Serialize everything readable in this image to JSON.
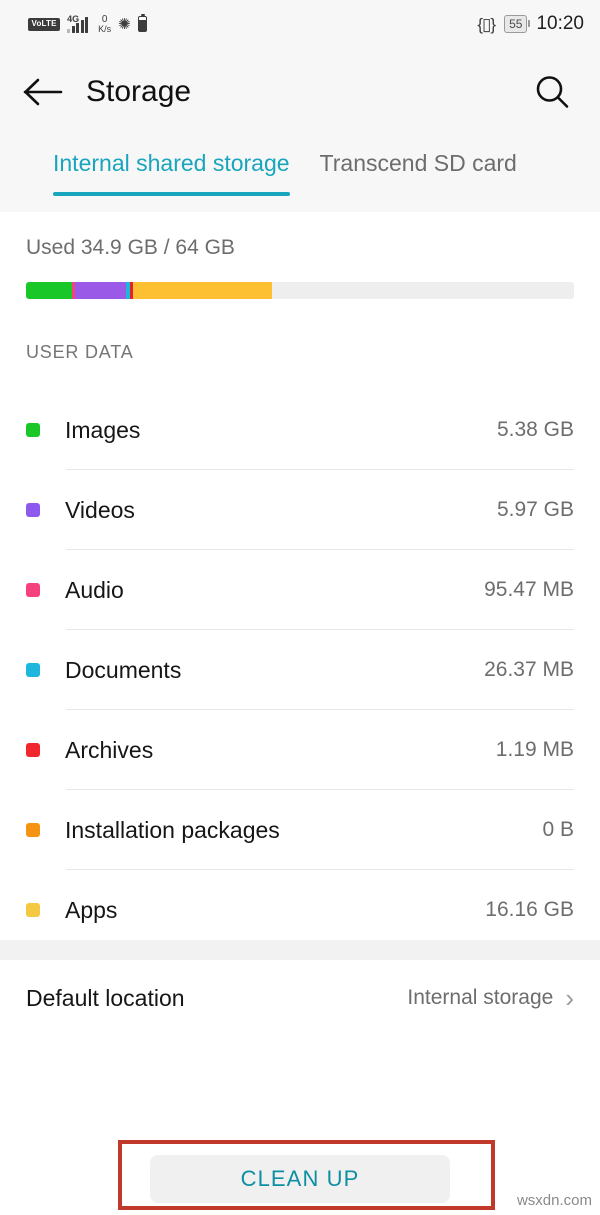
{
  "status_bar": {
    "volte_label": "VoLTE",
    "network_gen": "4G",
    "net_speed_value": "0",
    "net_speed_unit": "K/s",
    "bluetooth_icon": "bluetooth-icon",
    "battery_percent": "55",
    "time": "10:20"
  },
  "app_bar": {
    "back_icon": "back-arrow-icon",
    "title": "Storage",
    "search_icon": "search-icon"
  },
  "tabs": [
    {
      "label": "Internal shared storage",
      "active": true
    },
    {
      "label": "Transcend SD card",
      "active": false
    }
  ],
  "usage": {
    "used_text": "Used 34.9 GB / 64 GB",
    "used_gb": 34.9,
    "total_gb": 64,
    "segments": [
      {
        "name": "Images",
        "color": "#19c728",
        "percent": 8.4
      },
      {
        "name": "Audio",
        "color": "#f5427e",
        "percent": 0.6
      },
      {
        "name": "Videos",
        "color": "#9b59e8",
        "percent": 9.3
      },
      {
        "name": "Documents",
        "color": "#1fb6dd",
        "percent": 0.7
      },
      {
        "name": "Archives",
        "color": "#e8202a",
        "percent": 0.6
      },
      {
        "name": "Apps",
        "color": "#fcc032",
        "percent": 25.3
      }
    ],
    "track_color": "#eeeeee"
  },
  "section": {
    "user_data_heading": "USER DATA"
  },
  "categories": [
    {
      "label": "Images",
      "value": "5.38 GB",
      "color": "#19c728"
    },
    {
      "label": "Videos",
      "value": "5.97 GB",
      "color": "#8e59ef"
    },
    {
      "label": "Audio",
      "value": "95.47 MB",
      "color": "#f5427e"
    },
    {
      "label": "Documents",
      "value": "26.37 MB",
      "color": "#1fb6dd"
    },
    {
      "label": "Archives",
      "value": "1.19 MB",
      "color": "#f0272d"
    },
    {
      "label": "Installation packages",
      "value": "0 B",
      "color": "#f59412"
    },
    {
      "label": "Apps",
      "value": "16.16 GB",
      "color": "#f5c842"
    }
  ],
  "default_location": {
    "label": "Default location",
    "value": "Internal storage",
    "chevron_icon": "chevron-right-icon"
  },
  "cleanup": {
    "label": "CLEAN UP"
  },
  "annotation": {
    "color": "#c0392b"
  },
  "watermark": {
    "text": "wsxdn.com"
  },
  "theme": {
    "accent": "#18a5bd",
    "cleanup_text": "#0d8fa3"
  }
}
